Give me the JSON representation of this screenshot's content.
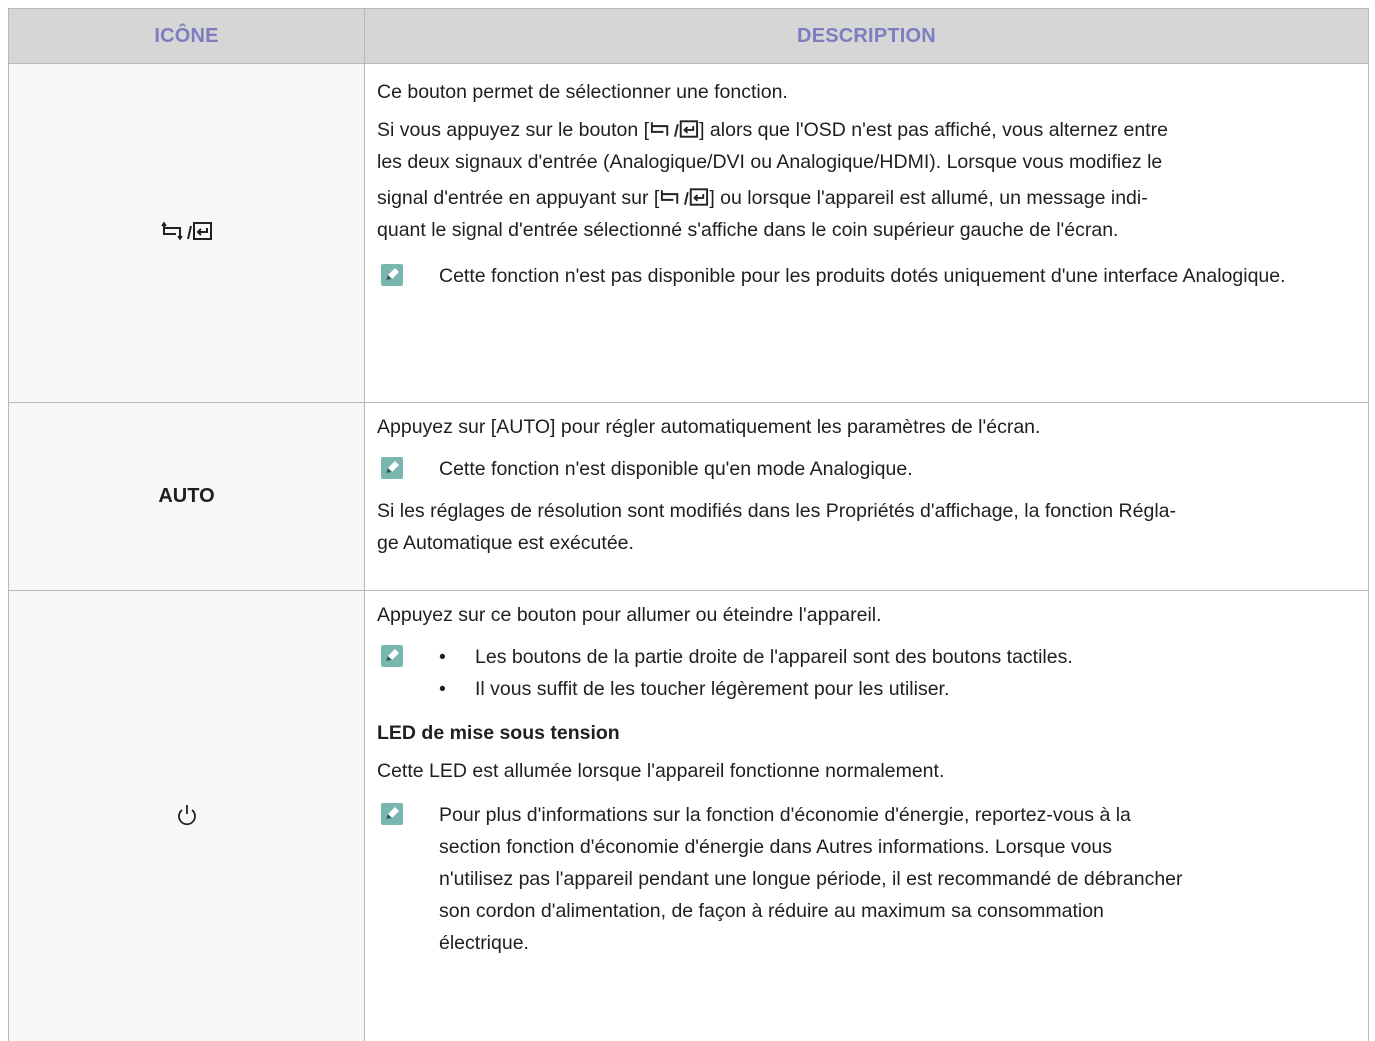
{
  "header": {
    "col1": "ICÔNE",
    "col2": "DESCRIPTION"
  },
  "rows": [
    {
      "icon_name": "source-enter-icon",
      "p1": "Ce bouton permet de sélectionner une fonction.",
      "p2_before": "Si vous appuyez sur le bouton [",
      "p2_line1_after": "] alors que l'OSD n'est pas affiché, vous alternez entre",
      "p2_line2": "les deux signaux d'entrée (Analogique/DVI ou Analogique/HDMI). Lorsque vous modifiez le",
      "p2_line3_before": "signal d'entrée en appuyant sur [",
      "p2_line3_after": "] ou lorsque l'appareil est allumé, un message indi-",
      "p2_line4": "quant le signal d'entrée sélectionné s'affiche dans le coin supérieur gauche de l'écran.",
      "note": "Cette fonction n'est pas disponible pour les produits dotés uniquement d'une interface Analogique."
    },
    {
      "icon_label": "AUTO",
      "p1": "Appuyez sur [AUTO] pour régler automatiquement les paramètres de l'écran.",
      "note": "Cette fonction n'est disponible qu'en mode Analogique.",
      "p2_line1": "Si les réglages de résolution sont modifiés dans les Propriétés d'affichage, la fonction Régla-",
      "p2_line2": "ge Automatique est exécutée."
    },
    {
      "icon_name": "power-icon",
      "p1": "Appuyez sur ce bouton pour allumer ou éteindre l'appareil.",
      "bullet_char": "•",
      "bullets": [
        "Les boutons de la partie droite de l'appareil sont des boutons tactiles.",
        "Il vous suffit de les toucher légèrement pour les utiliser."
      ],
      "subheading": "LED de mise sous tension",
      "p2": "Cette LED est allumée lorsque l'appareil fonctionne normalement.",
      "note_lines": [
        "Pour plus d'informations sur la fonction d'économie d'énergie, reportez-vous à la",
        "section fonction d'économie d'énergie dans Autres informations. Lorsque vous",
        "n'utilisez pas l'appareil pendant une longue période, il est recommandé de débrancher",
        "son cordon d'alimentation, de façon à réduire au maximum sa consommation",
        "électrique."
      ]
    }
  ],
  "colors": {
    "header_text": "#7d7dc0",
    "header_bg": "#d6d6d6",
    "border": "#b9b9b9",
    "note_icon": "#79b6b0"
  }
}
